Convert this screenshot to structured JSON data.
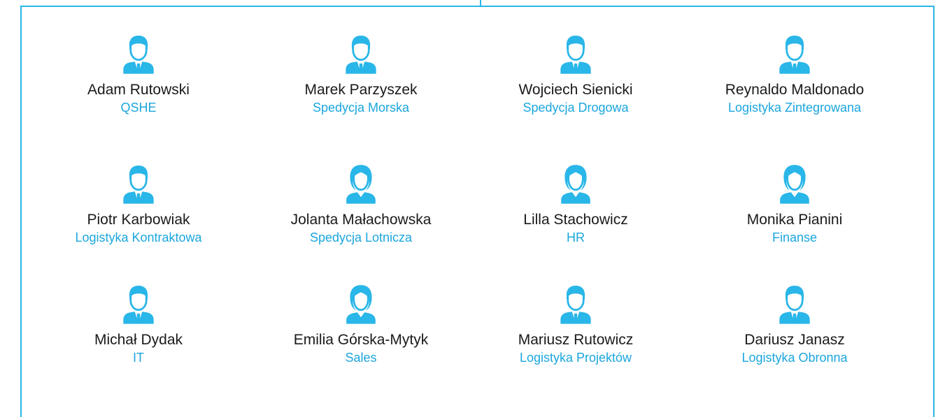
{
  "colors": {
    "accent": "#29b6e8",
    "name_text": "#1a1a1a",
    "department_text": "#1ba6dd"
  },
  "people": [
    {
      "name": "Adam Rutowski",
      "department": "QSHE",
      "icon": "male-user-icon"
    },
    {
      "name": "Marek Parzyszek",
      "department": "Spedycja Morska",
      "icon": "male-user-icon"
    },
    {
      "name": "Wojciech Sienicki",
      "department": "Spedycja Drogowa",
      "icon": "male-user-icon"
    },
    {
      "name": "Reynaldo Maldonado",
      "department": "Logistyka Zintegrowana",
      "icon": "male-user-icon"
    },
    {
      "name": "Piotr Karbowiak",
      "department": "Logistyka Kontraktowa",
      "icon": "male-user-icon"
    },
    {
      "name": "Jolanta Małachowska",
      "department": "Spedycja Lotnicza",
      "icon": "female-user-icon"
    },
    {
      "name": "Lilla Stachowicz",
      "department": "HR",
      "icon": "female-user-icon"
    },
    {
      "name": "Monika Pianini",
      "department": "Finanse",
      "icon": "female-user-icon"
    },
    {
      "name": "Michał Dydak",
      "department": "IT",
      "icon": "male-user-icon"
    },
    {
      "name": "Emilia Górska-Mytyk",
      "department": "Sales",
      "icon": "female-user-icon"
    },
    {
      "name": "Mariusz Rutowicz",
      "department": "Logistyka Projektów",
      "icon": "male-user-icon"
    },
    {
      "name": "Dariusz Janasz",
      "department": "Logistyka Obronna",
      "icon": "male-user-icon"
    }
  ]
}
